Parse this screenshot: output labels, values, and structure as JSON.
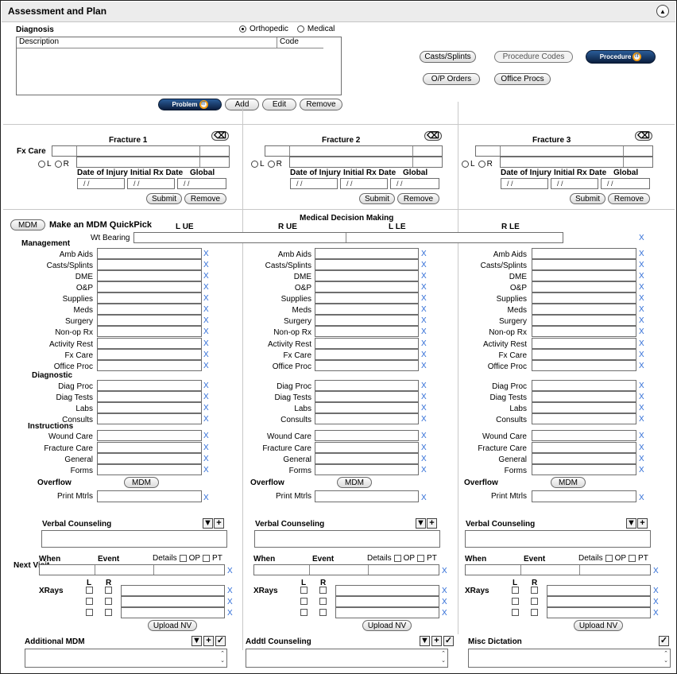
{
  "panel": {
    "title": "Assessment and Plan",
    "collapse_glyph": "▲"
  },
  "diagnosis": {
    "label": "Diagnosis",
    "type_options": [
      "Orthopedic",
      "Medical"
    ],
    "selected": "Orthopedic",
    "columns": [
      "Description",
      "Code"
    ]
  },
  "dx_buttons": {
    "problem_logo": "Problem",
    "it": "IT",
    "add": "Add",
    "edit": "Edit",
    "remove": "Remove"
  },
  "right_buttons": {
    "casts_splints": "Casts/Splints",
    "procedure_codes": "Procedure Codes",
    "procedure_logo": "Procedure",
    "op_orders": "O/P Orders",
    "office_procs": "Office Procs"
  },
  "fracture": {
    "fx_care": "Fx Care",
    "titles": [
      "Fracture 1",
      "Fracture 2",
      "Fracture 3"
    ],
    "side_l": "L",
    "side_r": "R",
    "doi": "Date of Injury",
    "initial_rx": "Initial Rx Date",
    "global": "Global",
    "date_placeholder": "/ /",
    "submit": "Submit",
    "remove": "Remove"
  },
  "mdm": {
    "button": "MDM",
    "quickpick": "Make an MDM QuickPick",
    "title": "Medical Decision Making",
    "limbs": [
      "L UE",
      "R UE",
      "L LE",
      "R LE"
    ],
    "wt_bearing": "Wt Bearing",
    "x": "X"
  },
  "sections": {
    "management": "Management",
    "diagnostic": "Diagnostic",
    "instructions": "Instructions"
  },
  "management_items": [
    "Amb  Aids",
    "Casts/Splints",
    "DME",
    "O&P",
    "Supplies",
    "Meds",
    "Surgery",
    "Non-op Rx",
    "Activity Rest",
    "Fx Care",
    "Office Proc"
  ],
  "diagnostic_items": [
    "Diag Proc",
    "Diag Tests",
    "Labs",
    "Consults"
  ],
  "instruction_items": [
    "Wound Care",
    "Fracture Care",
    "General",
    "Forms"
  ],
  "overflow": {
    "label": "Overflow",
    "button": "MDM",
    "print": "Print Mtrls"
  },
  "counseling": {
    "label": "Verbal Counseling"
  },
  "next_visit": {
    "label": "Next Visit",
    "when": "When",
    "event": "Event",
    "details": "Details",
    "op": "OP",
    "pt": "PT"
  },
  "xrays": {
    "label": "XRays",
    "l": "L",
    "r": "R",
    "upload": "Upload NV"
  },
  "bottom": {
    "col1": "Additional MDM",
    "col2": "Addtl Counseling",
    "col3": "Misc Dictation"
  },
  "icons": {
    "dropdown": "▼",
    "add": "+",
    "check": "✓",
    "up": "⌃",
    "down": "⌄"
  }
}
